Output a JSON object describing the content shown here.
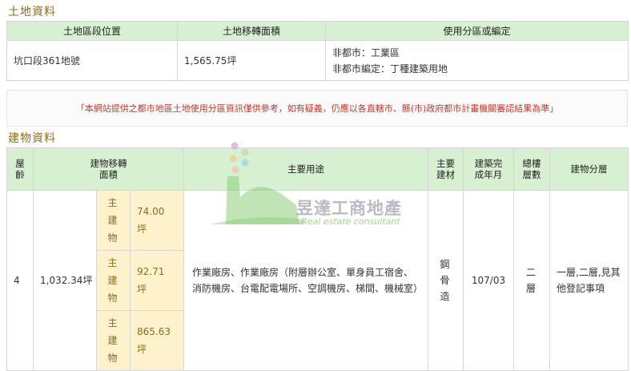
{
  "land_section": {
    "title": "土地資料",
    "headers": [
      "土地區段位置",
      "土地移轉面積",
      "使用分區或編定"
    ],
    "row": {
      "location": "坑口段361地號",
      "area": "1,565.75坪",
      "zoning": [
        "非都市：工業區",
        "非都市編定：丁種建築用地"
      ]
    }
  },
  "notice": "「本網站提供之都市地區土地使用分區資訊僅供參考，如有疑義，仍應以各直轄市、縣(市)政府都市計畫機關審認結果為準」",
  "building_section": {
    "title": "建物資料",
    "headers": {
      "age": "屋齡",
      "area": "建物移轉面積",
      "usage": "主要用途",
      "material": "主要建材",
      "completed": "建築完成年月",
      "total_floors": "總樓層數",
      "floors": "建物分層"
    },
    "row": {
      "age": "4",
      "area": "1,032.34坪",
      "sub_items": [
        {
          "label": "主建物",
          "value": "74.00坪"
        },
        {
          "label": "主建物",
          "value": "92.71坪"
        },
        {
          "label": "主建物",
          "value": "865.63坪"
        }
      ],
      "usage": "作業廠房、作業廠房（附層辦公室、單身員工宿舍、消防機房、台電配電場所、空調機房、梯間、機械室）",
      "material": "鋼骨造",
      "completed": "107/03",
      "total_floors": "二層",
      "floors": "一層,二層,見其他登記事項"
    }
  },
  "watermark": {
    "name": "昱達工商地產",
    "sub": "Real estate consultant"
  },
  "colors": {
    "header_bg": "#d8f0d2",
    "sub_bg": "#fdf2cc",
    "title_color": "#8a6d1f",
    "notice_color": "#c0392b"
  }
}
